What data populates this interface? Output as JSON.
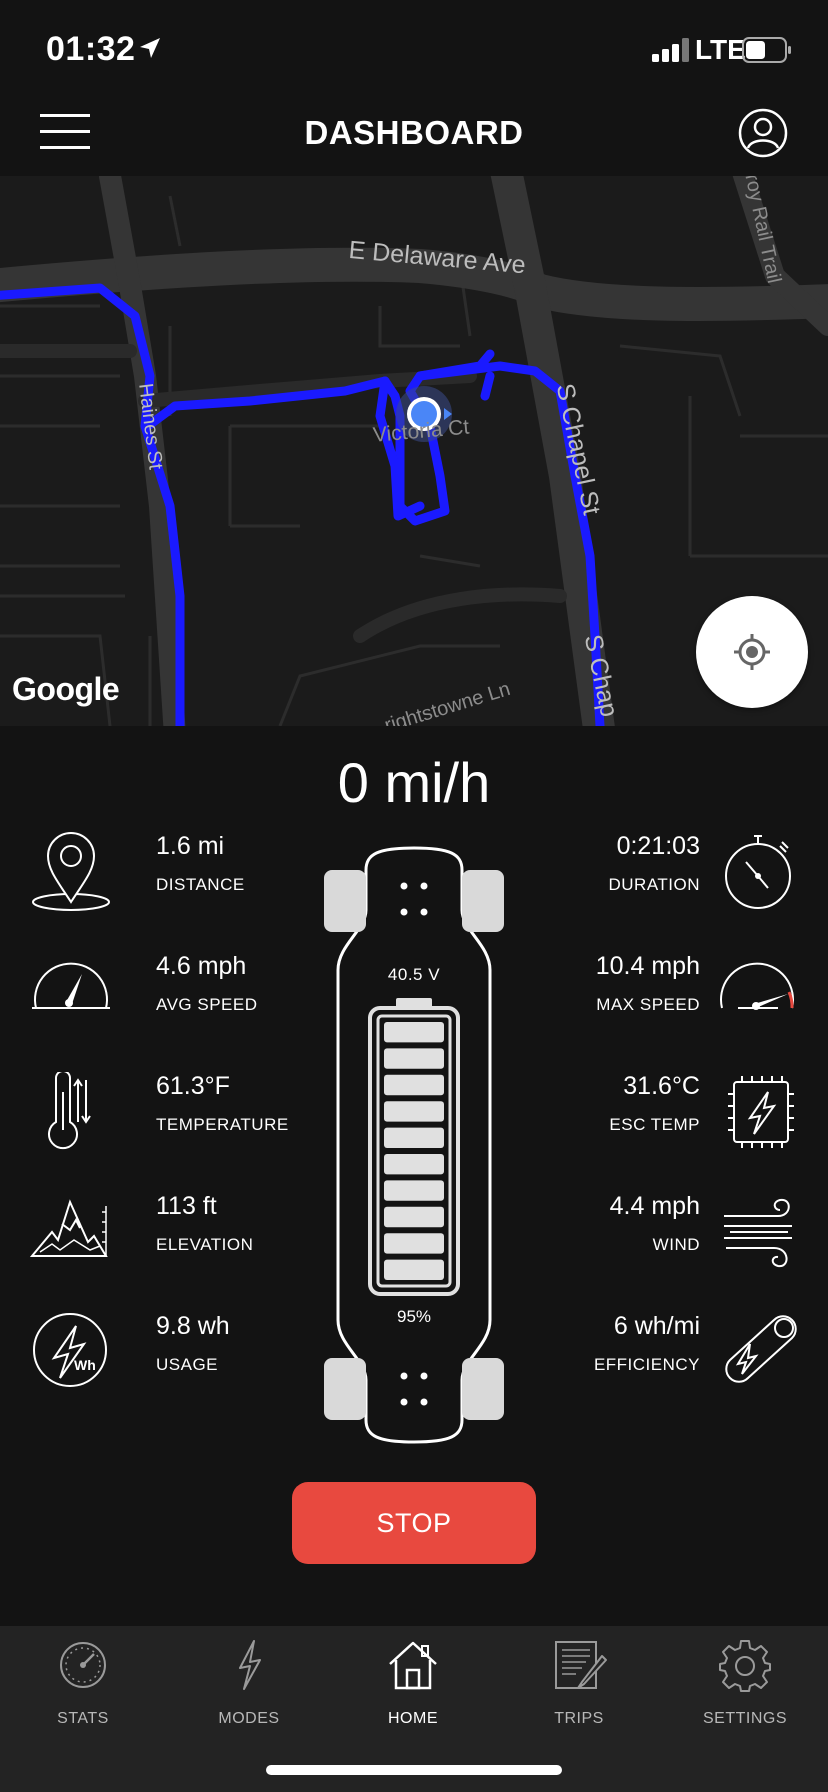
{
  "status_bar": {
    "time": "01:32",
    "network": "LTE"
  },
  "header": {
    "title": "DASHBOARD"
  },
  "map": {
    "streets": [
      "E Delaware Ave",
      "Victoria Ct",
      "Haines St",
      "S Chapel St",
      "S Chap",
      "rightstowne Ln",
      "roy Rail Trail"
    ],
    "logo": "Google",
    "route_color": "#1a1aff"
  },
  "speed": "0 mi/h",
  "stats": {
    "distance": {
      "value": "1.6 mi",
      "label": "DISTANCE"
    },
    "duration": {
      "value": "0:21:03",
      "label": "DURATION"
    },
    "avg_speed": {
      "value": "4.6 mph",
      "label": "AVG SPEED"
    },
    "max_speed": {
      "value": "10.4 mph",
      "label": "MAX SPEED"
    },
    "temperature": {
      "value": "61.3°F",
      "label": "TEMPERATURE"
    },
    "esc_temp": {
      "value": "31.6°C",
      "label": "ESC TEMP"
    },
    "elevation": {
      "value": "113 ft",
      "label": "ELEVATION"
    },
    "wind": {
      "value": "4.4 mph",
      "label": "WIND"
    },
    "usage": {
      "value": "9.8 wh",
      "label": "USAGE"
    },
    "efficiency": {
      "value": "6 wh/mi",
      "label": "EFFICIENCY"
    }
  },
  "board": {
    "voltage": "40.5 V",
    "battery_percent": "95%",
    "battery_level": 0.95
  },
  "stop_button": "STOP",
  "colors": {
    "accent_red": "#e8493f",
    "background": "#131313"
  },
  "tabs": [
    {
      "label": "STATS",
      "icon": "gauge-icon"
    },
    {
      "label": "MODES",
      "icon": "lightning-icon"
    },
    {
      "label": "HOME",
      "icon": "home-icon"
    },
    {
      "label": "TRIPS",
      "icon": "trips-icon"
    },
    {
      "label": "SETTINGS",
      "icon": "gear-icon"
    }
  ],
  "active_tab": "HOME"
}
